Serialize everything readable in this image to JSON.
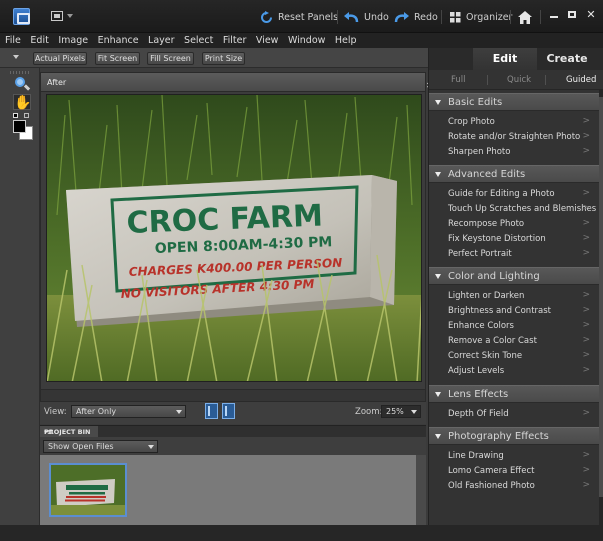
{
  "titlebar": {
    "reset_panels": "Reset Panels",
    "undo": "Undo",
    "redo": "Redo",
    "organizer": "Organizer"
  },
  "menu": [
    "File",
    "Edit",
    "Image",
    "Enhance",
    "Layer",
    "Select",
    "Filter",
    "View",
    "Window",
    "Help"
  ],
  "options": {
    "actual_pixels": "Actual Pixels",
    "fit_screen": "Fit Screen",
    "fill_screen": "Fill Screen",
    "print_size": "Print Size"
  },
  "document": {
    "title": "After",
    "sign_line1": "CROC FARM",
    "sign_line2": "OPEN 8:00AM-4:30 PM",
    "sign_line3": "CHARGES K400.00 PER PERSON",
    "sign_line4": "NO VISITORS AFTER 4:30 PM"
  },
  "viewbar": {
    "view_label": "View:",
    "view_value": "After Only",
    "zoom_label": "Zoom:",
    "zoom_value": "25%"
  },
  "project_bin": {
    "title": "PROJECT BIN",
    "filter": "Show Open Files"
  },
  "panel": {
    "mode_tabs": [
      "Edit",
      "Create"
    ],
    "sub_tabs": [
      "Full",
      "Quick",
      "Guided"
    ],
    "active_sub_tab": "Guided",
    "sections": [
      {
        "title": "Basic Edits",
        "items": [
          "Crop Photo",
          "Rotate and/or Straighten Photo",
          "Sharpen Photo"
        ]
      },
      {
        "title": "Advanced Edits",
        "items": [
          "Guide for Editing a Photo",
          "Touch Up Scratches and Blemishes",
          "Recompose Photo",
          "Fix Keystone Distortion",
          "Perfect Portrait"
        ]
      },
      {
        "title": "Color and Lighting",
        "items": [
          "Lighten or Darken",
          "Brightness and Contrast",
          "Enhance Colors",
          "Remove a Color Cast",
          "Correct Skin Tone",
          "Adjust Levels"
        ]
      },
      {
        "title": "Lens Effects",
        "items": [
          "Depth Of Field"
        ]
      },
      {
        "title": "Photography Effects",
        "items": [
          "Line Drawing",
          "Lomo Camera Effect",
          "Old Fashioned Photo"
        ]
      }
    ]
  },
  "colors": {
    "accent_blue": "#3d82d6",
    "sign_green": "#1f6b44",
    "sign_red": "#b8322a"
  }
}
